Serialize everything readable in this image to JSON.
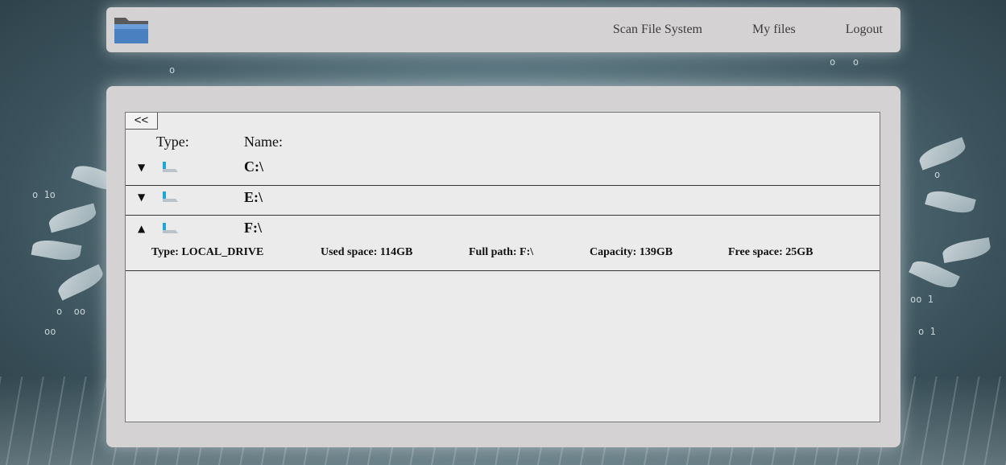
{
  "header": {
    "logo_icon": "folder-icon",
    "nav": [
      {
        "label": "Scan File System"
      },
      {
        "label": "My files"
      },
      {
        "label": "Logout"
      }
    ]
  },
  "browser": {
    "back_label": "<<",
    "columns": {
      "type": "Type:",
      "name": "Name:"
    },
    "drives": [
      {
        "toggle": "▼",
        "icon": "drive-icon",
        "name": "C:\\",
        "expanded": false
      },
      {
        "toggle": "▼",
        "icon": "drive-icon",
        "name": "E:\\",
        "expanded": false
      },
      {
        "toggle": "▲",
        "icon": "drive-icon",
        "name": "F:\\",
        "expanded": true,
        "details": {
          "type": "Type: LOCAL_DRIVE",
          "used": "Used space: 114GB",
          "path": "Full path: F:\\",
          "capacity": "Capacity: 139GB",
          "free": "Free space: 25GB"
        }
      }
    ]
  },
  "colors": {
    "panel_bg": "#d4d2d2",
    "content_bg": "#ebebeb",
    "drive_blue": "#1fa4e0"
  }
}
